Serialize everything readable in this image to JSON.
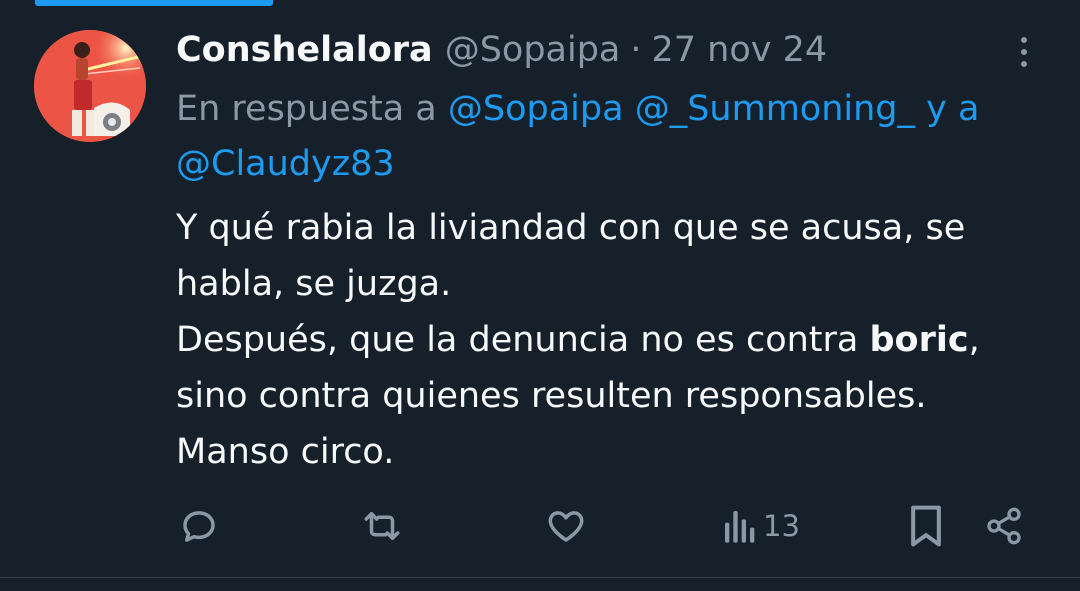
{
  "tweet": {
    "display_name": "Conshelalora",
    "handle": "@Sopaipa",
    "separator": "·",
    "date": "27 nov 24",
    "reply_prefix": "En respuesta a",
    "reply_mentions": [
      "@Sopaipa",
      "@_Summoning_",
      "@Claudyz83"
    ],
    "reply_and": "y a",
    "body": {
      "line1": "Y qué rabia la liviandad con que se acusa, se habla, se juzga.",
      "line2_before": "Después, que la denuncia no es contra",
      "line2_bold": "boric",
      "line2_after": ", sino contra quienes resulten responsables.",
      "line3": "Manso circo."
    }
  },
  "actions": {
    "reply_icon": "reply-icon",
    "retweet_icon": "retweet-icon",
    "like_icon": "heart-icon",
    "views_icon": "views-icon",
    "views_count": "13",
    "bookmark_icon": "bookmark-icon",
    "share_icon": "share-icon"
  },
  "colors": {
    "background": "#15202b",
    "text": "#f7f9f9",
    "secondary": "#8b98a5",
    "accent": "#1d9bf0",
    "divider": "#38444d"
  }
}
